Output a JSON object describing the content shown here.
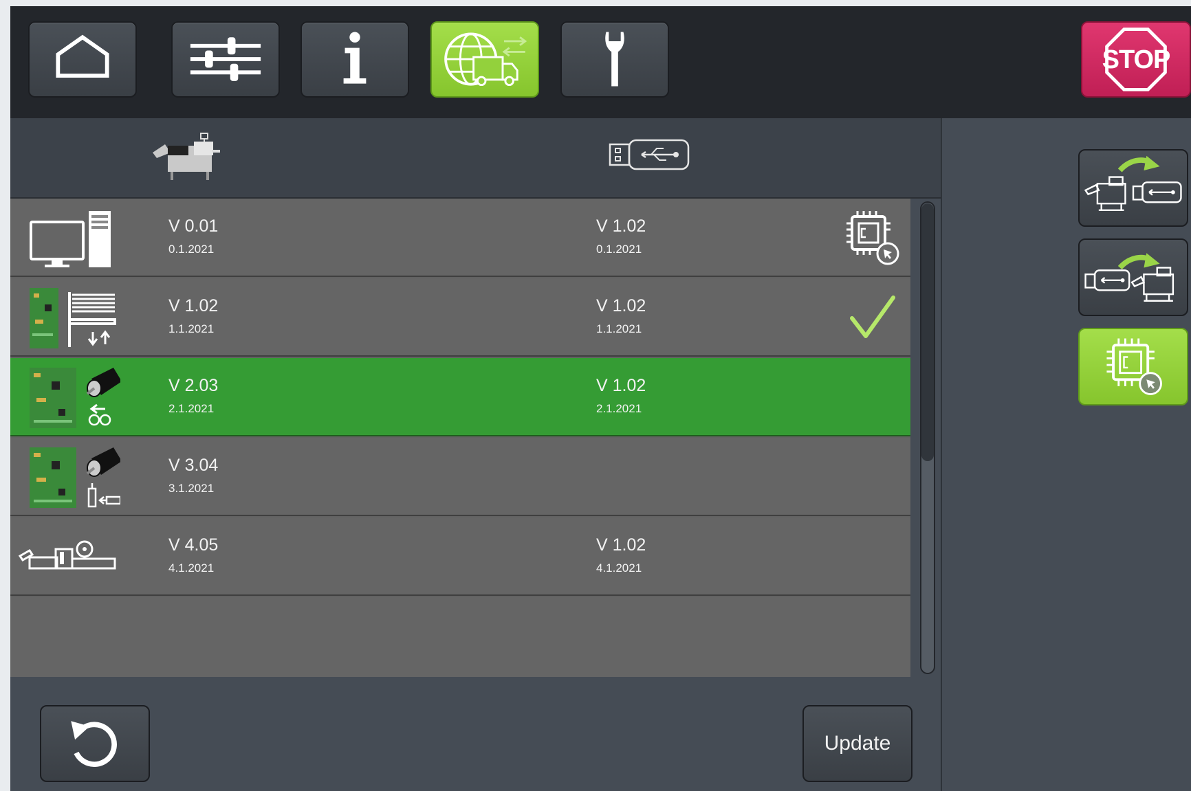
{
  "nav": {
    "buttons": [
      {
        "icon": "home-icon",
        "active": false
      },
      {
        "icon": "sliders-icon",
        "active": false
      },
      {
        "icon": "info-icon",
        "active": false
      },
      {
        "icon": "globe-transfer-icon",
        "active": true
      },
      {
        "icon": "wrench-icon",
        "active": false
      }
    ],
    "stop_label": "STOP"
  },
  "columns": {
    "machine_icon": "machine-icon",
    "usb_icon": "usb-drive-icon"
  },
  "rows": [
    {
      "icon": "computer-icon",
      "machine_version": "V 0.01",
      "machine_date": "0.1.2021",
      "usb_version": "V 1.02",
      "usb_date": "0.1.2021",
      "status": "chip-cursor-icon",
      "selected": false
    },
    {
      "icon": "board-stacker-icon",
      "machine_version": "V 1.02",
      "machine_date": "1.1.2021",
      "usb_version": "V 1.02",
      "usb_date": "1.1.2021",
      "status": "checkmark-icon",
      "selected": false
    },
    {
      "icon": "board-motor-feed-icon",
      "machine_version": "V 2.03",
      "machine_date": "2.1.2021",
      "usb_version": "V 1.02",
      "usb_date": "2.1.2021",
      "status": "",
      "selected": true
    },
    {
      "icon": "board-motor-glue-icon",
      "machine_version": "V 3.04",
      "machine_date": "3.1.2021",
      "usb_version": "",
      "usb_date": "",
      "status": "",
      "selected": false
    },
    {
      "icon": "cutter-unit-icon",
      "machine_version": "V 4.05",
      "machine_date": "4.1.2021",
      "usb_version": "V 1.02",
      "usb_date": "4.1.2021",
      "status": "",
      "selected": false
    }
  ],
  "footer": {
    "reset_icon": "reset-icon",
    "update_label": "Update"
  },
  "side": {
    "buttons": [
      {
        "icon": "machine-to-usb-icon",
        "active": false
      },
      {
        "icon": "usb-to-machine-icon",
        "active": false
      },
      {
        "icon": "firmware-chip-icon",
        "active": true
      }
    ]
  },
  "colors": {
    "accent_green": "#8fcf35",
    "selected_row": "#359c34",
    "stop_red": "#d12a61",
    "check_green": "#b6e86a"
  }
}
